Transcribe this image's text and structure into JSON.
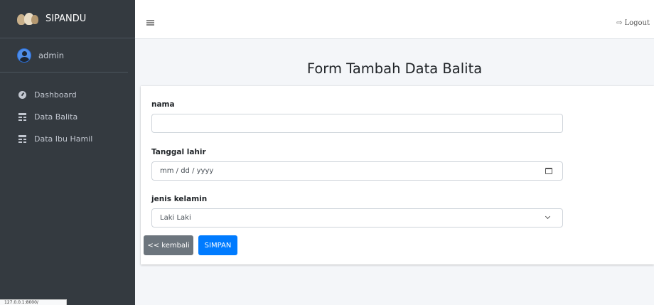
{
  "sidebar": {
    "brand": "SIPANDU",
    "user": "admin",
    "items": [
      {
        "label": "Dashboard",
        "icon": "dashboard-icon"
      },
      {
        "label": "Data Balita",
        "icon": "table-icon"
      },
      {
        "label": "Data Ibu Hamil",
        "icon": "table-icon"
      }
    ]
  },
  "topbar": {
    "menu_icon": "hamburger-icon",
    "logout_label": "Logout",
    "logout_icon": "sign-out-icon"
  },
  "page": {
    "title": "Form Tambah Data Balita"
  },
  "form": {
    "nama_label": "nama",
    "nama_value": "",
    "tanggal_label": "Tanggal lahir",
    "tanggal_placeholder": "mm / dd / yyyy",
    "jenis_label": "jenis kelamin",
    "jenis_selected": "Laki Laki",
    "back_label": "<< kembali",
    "save_label": "SIMPAN"
  },
  "status_bar": {
    "url": "127.0.0.1:8000/"
  },
  "colors": {
    "sidebar_bg": "#343a40",
    "primary": "#007bff",
    "secondary": "#6c757d"
  }
}
